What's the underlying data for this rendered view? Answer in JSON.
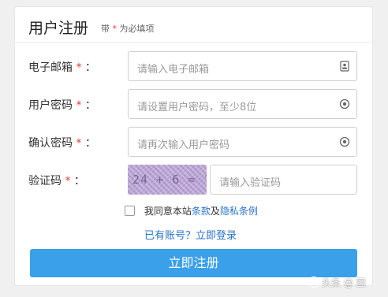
{
  "header": {
    "title": "用户注册",
    "subtitle_prefix": "带",
    "required_mark": "*",
    "subtitle_suffix": "为必填项"
  },
  "form": {
    "email": {
      "label": "电子邮箱",
      "placeholder": "请输入电子邮箱",
      "icon": "id-card-icon"
    },
    "password": {
      "label": "用户密码",
      "placeholder": "请设置用户密码，至少8位",
      "icon": "eye-icon"
    },
    "confirm_password": {
      "label": "确认密码",
      "placeholder": "请再次输入用户密码",
      "icon": "eye-icon"
    },
    "captcha": {
      "label": "验证码",
      "image_text": "24 + 6  = ?",
      "placeholder": "请输入验证码"
    },
    "required_mark": "*",
    "label_colon": "："
  },
  "agreement": {
    "prefix": "我同意本站",
    "terms_link": "条款",
    "and": "及",
    "privacy_link": "隐私条例"
  },
  "login_link": "已有账号？立即登录",
  "submit_label": "立即注册",
  "watermark": "头条 @ 图",
  "colors": {
    "accent_blue": "#3aa0ea",
    "link_blue": "#2a73c8",
    "required_red": "#e23b3b"
  }
}
